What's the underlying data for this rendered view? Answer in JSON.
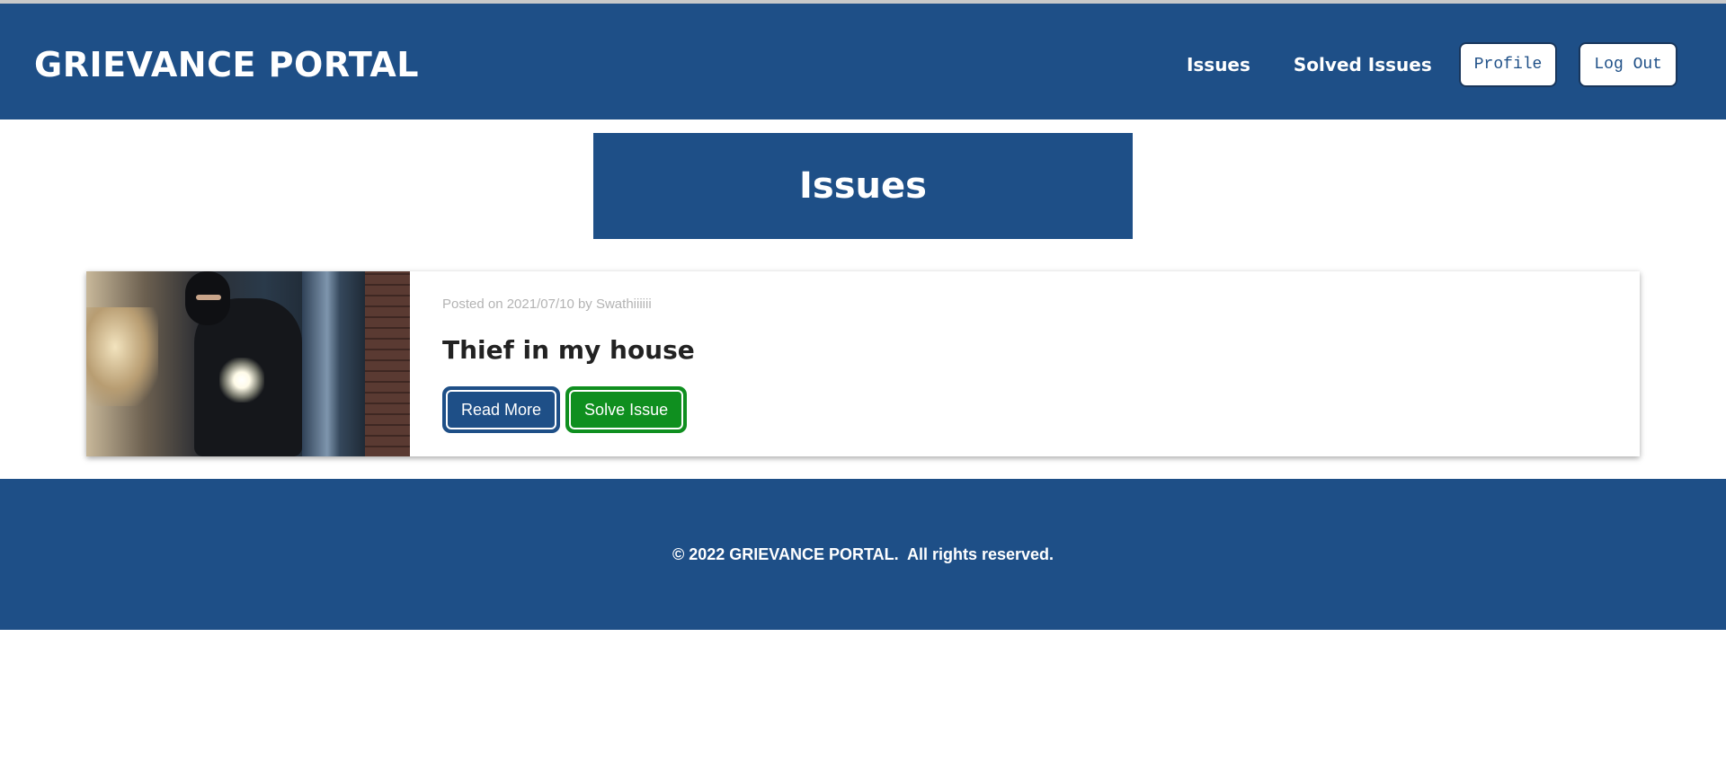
{
  "header": {
    "brand": "GRIEVANCE PORTAL",
    "nav": {
      "issues": "Issues",
      "solved_issues": "Solved Issues",
      "profile": "Profile",
      "logout": "Log Out"
    }
  },
  "page": {
    "title": "Issues"
  },
  "issues": [
    {
      "meta": "Posted on 2021/07/10 by Swathiiiiii",
      "title": "Thief in my house",
      "read_more": "Read More",
      "solve": "Solve Issue"
    }
  ],
  "footer": {
    "copyright": "© 2022 GRIEVANCE PORTAL.  All rights reserved."
  },
  "colors": {
    "primary": "#1e4f87",
    "success": "#0f8f1f"
  }
}
